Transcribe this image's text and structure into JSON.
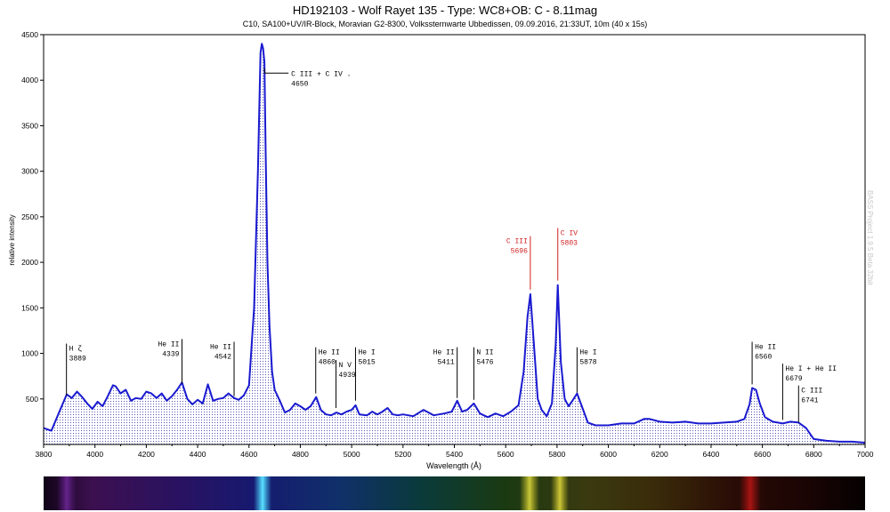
{
  "chart_data": {
    "type": "line",
    "title": "HD192103 -  Wolf Rayet 135 - Type: WC8+OB: C - 8.11mag",
    "subtitle": "C10, SA100+UV/IR-Block, Moravian G2-8300, Volkssternwarte Ubbedissen, 09.09.2016, 21:33UT, 10m (40 x 15s)",
    "xlabel": "Wavelength (Å)",
    "ylabel": "relative intensity",
    "xlim": [
      3800,
      7000
    ],
    "ylim": [
      0,
      4500
    ],
    "x_ticks": [
      3800,
      4000,
      4200,
      4400,
      4600,
      4800,
      5000,
      5200,
      5400,
      5600,
      5800,
      6000,
      6200,
      6400,
      6600,
      6800,
      7000
    ],
    "y_ticks": [
      500,
      1000,
      1500,
      2000,
      2500,
      3000,
      3500,
      4000,
      4500
    ],
    "grid": false,
    "line_color": "#1a1ad0",
    "fill": "dotted",
    "series": [
      {
        "x": [
          3800,
          3830,
          3860,
          3890,
          3910,
          3930,
          3950,
          3970,
          3990,
          4010,
          4030,
          4050,
          4070,
          4080,
          4100,
          4120,
          4140,
          4160,
          4180,
          4200,
          4220,
          4240,
          4260,
          4280,
          4300,
          4320,
          4339,
          4360,
          4380,
          4400,
          4420,
          4440,
          4460,
          4480,
          4500,
          4520,
          4542,
          4560,
          4580,
          4600,
          4620,
          4635,
          4645,
          4650,
          4655,
          4660,
          4665,
          4672,
          4680,
          4690,
          4700,
          4720,
          4740,
          4760,
          4780,
          4800,
          4820,
          4840,
          4862,
          4880,
          4900,
          4920,
          4940,
          4960,
          4980,
          5000,
          5015,
          5030,
          5060,
          5080,
          5100,
          5120,
          5140,
          5160,
          5180,
          5200,
          5240,
          5280,
          5320,
          5360,
          5390,
          5411,
          5430,
          5450,
          5476,
          5500,
          5530,
          5560,
          5590,
          5620,
          5650,
          5670,
          5685,
          5696,
          5710,
          5725,
          5740,
          5760,
          5780,
          5795,
          5803,
          5815,
          5830,
          5845,
          5860,
          5878,
          5895,
          5920,
          5950,
          6000,
          6050,
          6100,
          6140,
          6160,
          6200,
          6250,
          6300,
          6350,
          6400,
          6450,
          6500,
          6530,
          6550,
          6560,
          6575,
          6590,
          6610,
          6640,
          6679,
          6710,
          6741,
          6770,
          6800,
          6850,
          6900,
          6950,
          7000
        ],
        "y": [
          180,
          150,
          350,
          550,
          510,
          580,
          520,
          450,
          390,
          470,
          420,
          530,
          650,
          640,
          560,
          600,
          480,
          510,
          500,
          580,
          560,
          510,
          560,
          480,
          530,
          600,
          680,
          500,
          440,
          490,
          450,
          660,
          480,
          500,
          510,
          560,
          510,
          490,
          540,
          650,
          1500,
          3000,
          4300,
          4400,
          4350,
          4200,
          3200,
          2000,
          1300,
          800,
          600,
          480,
          350,
          380,
          450,
          420,
          380,
          420,
          520,
          380,
          330,
          320,
          350,
          330,
          360,
          380,
          430,
          330,
          320,
          360,
          330,
          360,
          400,
          330,
          320,
          330,
          310,
          380,
          320,
          340,
          360,
          480,
          360,
          380,
          450,
          340,
          300,
          340,
          310,
          360,
          430,
          800,
          1400,
          1650,
          1100,
          500,
          380,
          310,
          450,
          1100,
          1750,
          900,
          500,
          420,
          480,
          560,
          430,
          240,
          210,
          210,
          230,
          230,
          280,
          280,
          250,
          240,
          250,
          230,
          230,
          240,
          250,
          280,
          440,
          620,
          600,
          450,
          300,
          250,
          230,
          250,
          240,
          180,
          60,
          40,
          30,
          30,
          20
        ]
      }
    ],
    "annotations": [
      {
        "line1": "H ζ",
        "line2": "3889",
        "wavelength": 3889,
        "y_label": 1000,
        "y_tick_bottom": 540,
        "color": "#000000",
        "side": "right"
      },
      {
        "line1": "He II",
        "line2": "4339",
        "wavelength": 4339,
        "y_label": 1050,
        "y_tick_bottom": 670,
        "color": "#000000",
        "side": "left"
      },
      {
        "line1": "He II",
        "line2": "4542",
        "wavelength": 4542,
        "y_label": 1020,
        "y_tick_bottom": 530,
        "color": "#000000",
        "side": "left"
      },
      {
        "line1": "C III + C IV  .",
        "line2": "4650",
        "wavelength": 4650,
        "y_label": 3980,
        "y_tick_bottom": 4130,
        "color": "#000000",
        "side": "right",
        "connector": true
      },
      {
        "line1": "He II",
        "line2": "4860",
        "wavelength": 4860,
        "y_label": 960,
        "y_tick_bottom": 560,
        "color": "#000000",
        "side": "right"
      },
      {
        "line1": "N V",
        "line2": "4939",
        "wavelength": 4939,
        "y_label": 820,
        "y_tick_bottom": 400,
        "color": "#000000",
        "side": "right"
      },
      {
        "line1": "He I",
        "line2": "5015",
        "wavelength": 5015,
        "y_label": 960,
        "y_tick_bottom": 480,
        "color": "#000000",
        "side": "right"
      },
      {
        "line1": "He II",
        "line2": "5411",
        "wavelength": 5411,
        "y_label": 960,
        "y_tick_bottom": 510,
        "color": "#000000",
        "side": "left"
      },
      {
        "line1": "N II",
        "line2": "5476",
        "wavelength": 5476,
        "y_label": 960,
        "y_tick_bottom": 490,
        "color": "#000000",
        "side": "right"
      },
      {
        "line1": "C III",
        "line2": "5696",
        "wavelength": 5696,
        "y_label": 2180,
        "y_tick_bottom": 1700,
        "color": "#d02020",
        "side": "left"
      },
      {
        "line1": "C IV",
        "line2": "5803",
        "wavelength": 5803,
        "y_label": 2270,
        "y_tick_bottom": 1800,
        "color": "#d02020",
        "side": "right"
      },
      {
        "line1": "He I",
        "line2": "5878",
        "wavelength": 5878,
        "y_label": 960,
        "y_tick_bottom": 570,
        "color": "#000000",
        "side": "right"
      },
      {
        "line1": "He II",
        "line2": "6560",
        "wavelength": 6560,
        "y_label": 1020,
        "y_tick_bottom": 660,
        "color": "#000000",
        "side": "right"
      },
      {
        "line1": "He I + He II",
        "line2": "6679",
        "wavelength": 6679,
        "y_label": 780,
        "y_tick_bottom": 270,
        "color": "#000000",
        "side": "right"
      },
      {
        "line1": "C III",
        "line2": "6741",
        "wavelength": 6741,
        "y_label": 540,
        "y_tick_bottom": 240,
        "color": "#000000",
        "side": "right"
      }
    ]
  },
  "watermark": "BASS Project 1.9.5 Beta 32bit"
}
